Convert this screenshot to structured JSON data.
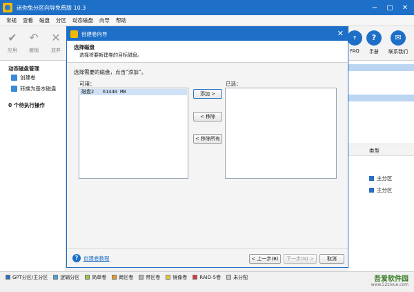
{
  "window": {
    "title": "迷你兔分区向导免费版 10.3"
  },
  "menu": [
    "常规",
    "查看",
    "磁盘",
    "分区",
    "动态磁盘",
    "向导",
    "帮助"
  ],
  "toolbar": {
    "apply": "应用",
    "undo": "撤销",
    "discard": "放弃",
    "faq": "FAQ",
    "manual": "手册",
    "contact": "联系我们"
  },
  "left_panel": {
    "heading": "动态磁盘管理",
    "items": [
      "创建卷",
      "转换为基本磁盘"
    ],
    "pending": "0 个待执行操作"
  },
  "right_panel": {
    "column_type": "类型",
    "rows": [
      "主分区",
      "主分区"
    ]
  },
  "dialog": {
    "title": "创建卷向导",
    "header_title": "选择磁盘",
    "header_sub": "选择将要新建卷的目标磁盘。",
    "instruction": "选择需要的磁盘，点击“添加”。",
    "available_label": "可用：",
    "selected_label": "已选：",
    "available_rows": [
      {
        "name": "磁盘2",
        "size": "61440 MB"
      }
    ],
    "add_btn": "添加 >",
    "remove_btn": "< 移除",
    "remove_all_btn": "< 移除所有",
    "help_link": "创建卷教程",
    "back_btn": "< 上一步(B)",
    "next_btn": "下一步(N) >",
    "cancel_btn": "取消"
  },
  "legend": [
    {
      "label": "GPT分区/主分区",
      "color": "#2a6fc0"
    },
    {
      "label": "逻辑分区",
      "color": "#47a4dc"
    },
    {
      "label": "简单卷",
      "color": "#9bc53d"
    },
    {
      "label": "跨区卷",
      "color": "#e0982f"
    },
    {
      "label": "带区卷",
      "color": "#b0b0b0"
    },
    {
      "label": "镜像卷",
      "color": "#e8c53a"
    },
    {
      "label": "RAID-5卷",
      "color": "#d9383a"
    },
    {
      "label": "未分配",
      "color": "#c8c8c8"
    }
  ],
  "watermark": {
    "text": "吾爱软件园",
    "url": "www.52zixue.com"
  }
}
